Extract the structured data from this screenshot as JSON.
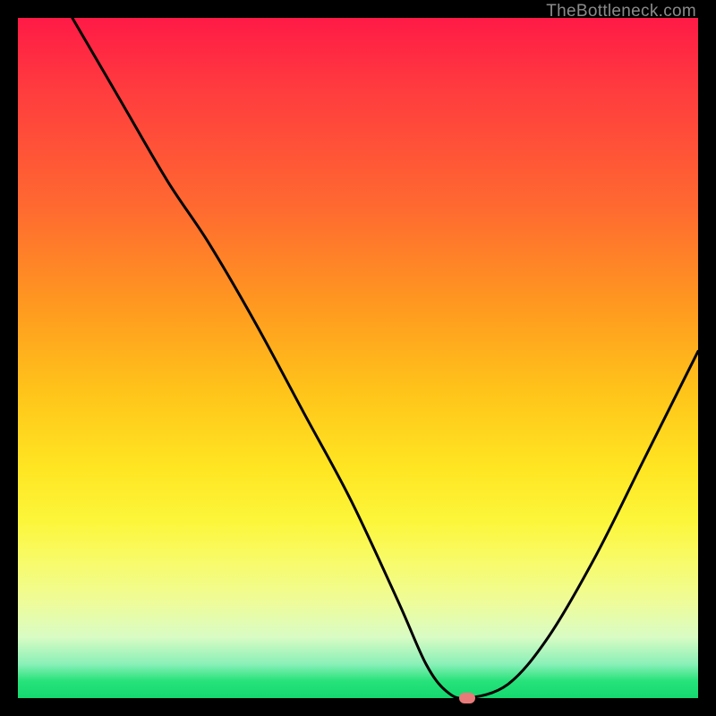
{
  "attribution": "TheBottleneck.com",
  "colors": {
    "marker": "#e97a7a",
    "curve": "#000000"
  },
  "chart_data": {
    "type": "line",
    "title": "",
    "xlabel": "",
    "ylabel": "",
    "xlim": [
      0,
      100
    ],
    "ylim": [
      0,
      100
    ],
    "grid": false,
    "legend": false,
    "background": "red-to-green vertical gradient",
    "series": [
      {
        "name": "bottleneck-curve",
        "x": [
          8,
          15,
          22,
          28,
          35,
          42,
          49,
          56,
          60,
          63,
          66,
          72,
          78,
          85,
          92,
          100
        ],
        "y": [
          100,
          88,
          76,
          67,
          55,
          42,
          29,
          14,
          5,
          1,
          0,
          2,
          9,
          21,
          35,
          51
        ]
      }
    ],
    "annotations": [
      {
        "name": "optimal-point-marker",
        "x": 66,
        "y": 0,
        "shape": "rounded-rect",
        "color": "#e97a7a"
      }
    ]
  }
}
